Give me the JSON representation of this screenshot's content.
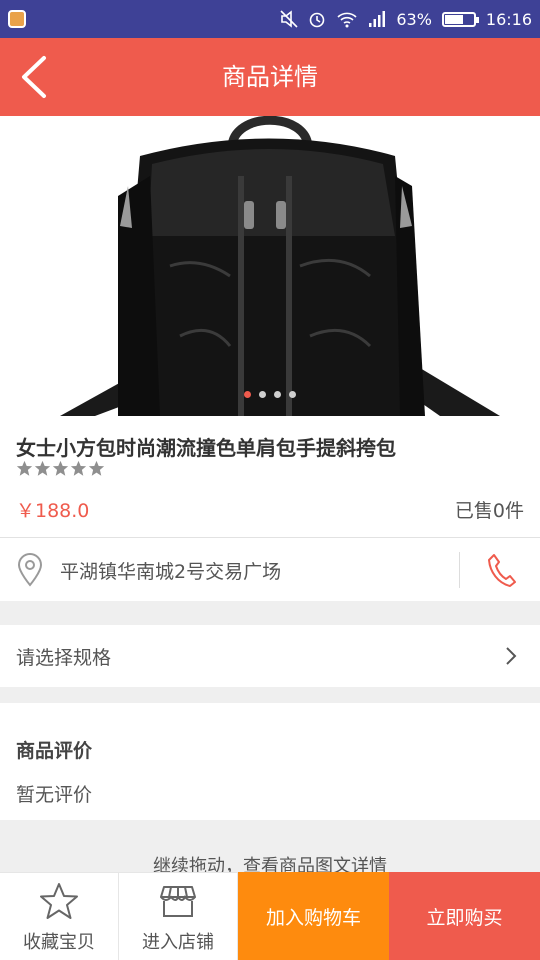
{
  "status_bar": {
    "battery_percent": "63%",
    "battery_level": 0.63,
    "time": "16:16"
  },
  "header": {
    "title": "商品详情",
    "background": "#ef5b4d"
  },
  "product": {
    "title": "女士小方包时尚潮流撞色单肩包手提斜挎包",
    "rating_stars": 5,
    "price": "￥188.0",
    "sold": "已售0件",
    "image_count": 4,
    "active_image": 1
  },
  "store": {
    "address": "平湖镇华南城2号交易广场"
  },
  "spec": {
    "label": "请选择规格"
  },
  "reviews": {
    "title": "商品评价",
    "empty_text": "暂无评价"
  },
  "hint": {
    "drag_text": "继续拖动，查看商品图文详情"
  },
  "bottom_bar": {
    "favorite_label": "收藏宝贝",
    "store_label": "进入店铺",
    "add_cart_label": "加入购物车",
    "buy_now_label": "立即购买",
    "cart_color": "#fe8b0e",
    "buy_color": "#ef5b4d"
  }
}
